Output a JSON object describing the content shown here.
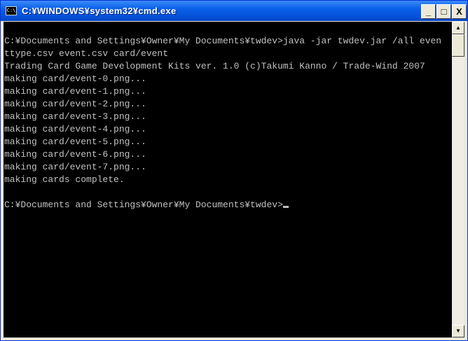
{
  "window": {
    "title": "C:¥WINDOWS¥system32¥cmd.exe",
    "icon": "cmd-icon",
    "icon_text": "C:\\",
    "minimize_label": "_",
    "maximize_label": "□",
    "close_label": "X"
  },
  "console": {
    "lines": [
      "",
      "C:¥Documents and Settings¥Owner¥My Documents¥twdev>java -jar twdev.jar /all even",
      "ttype.csv event.csv card/event",
      "Trading Card Game Development Kits ver. 1.0 (c)Takumi Kanno / Trade-Wind 2007",
      "making card/event-0.png...",
      "making card/event-1.png...",
      "making card/event-2.png...",
      "making card/event-3.png...",
      "making card/event-4.png...",
      "making card/event-5.png...",
      "making card/event-6.png...",
      "making card/event-7.png...",
      "making cards complete.",
      ""
    ],
    "prompt": "C:¥Documents and Settings¥Owner¥My Documents¥twdev>"
  },
  "scrollbar": {
    "up_label": "▲",
    "down_label": "▼"
  }
}
